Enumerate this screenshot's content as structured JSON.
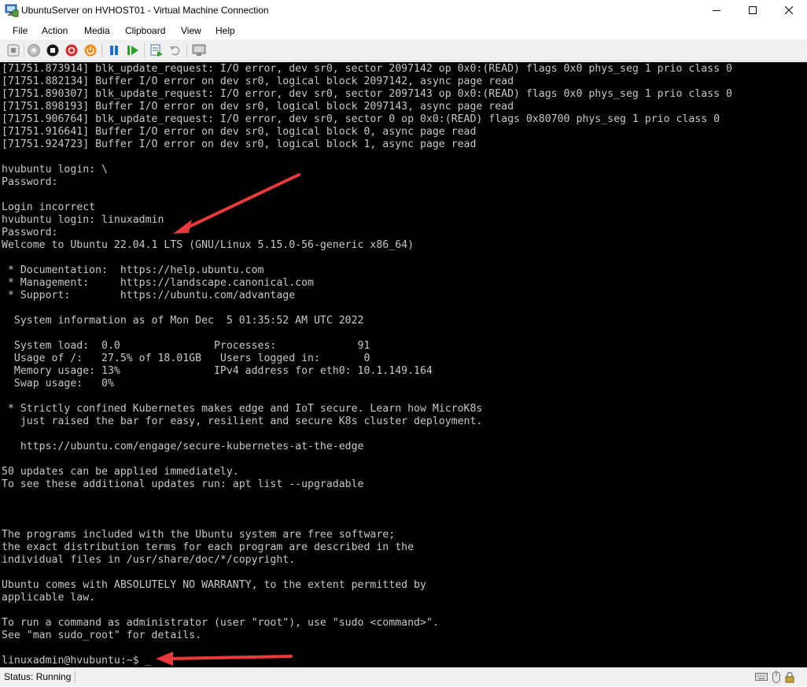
{
  "window": {
    "title": "UbuntuServer on HVHOST01 - Virtual Machine Connection",
    "icon": "vm-connection-icon",
    "controls": [
      "minimize-icon",
      "maximize-icon",
      "close-icon"
    ]
  },
  "menu": {
    "items": [
      {
        "label": "File"
      },
      {
        "label": "Action"
      },
      {
        "label": "Media"
      },
      {
        "label": "Clipboard"
      },
      {
        "label": "View"
      },
      {
        "label": "Help"
      }
    ]
  },
  "toolbar": {
    "buttons": [
      "ctrl-alt-del-icon",
      "start-icon",
      "turn-off-icon",
      "shutdown-icon",
      "save-icon",
      "pause-icon",
      "resume-icon",
      "checkpoint-icon",
      "revert-icon",
      "enhanced-session-icon"
    ]
  },
  "console": {
    "text": "[71751.873914] blk_update_request: I/O error, dev sr0, sector 2097142 op 0x0:(READ) flags 0x0 phys_seg 1 prio class 0\n[71751.882134] Buffer I/O error on dev sr0, logical block 2097142, async page read\n[71751.890307] blk_update_request: I/O error, dev sr0, sector 2097143 op 0x0:(READ) flags 0x0 phys_seg 1 prio class 0\n[71751.898193] Buffer I/O error on dev sr0, logical block 2097143, async page read\n[71751.906764] blk_update_request: I/O error, dev sr0, sector 0 op 0x0:(READ) flags 0x80700 phys_seg 1 prio class 0\n[71751.916641] Buffer I/O error on dev sr0, logical block 0, async page read\n[71751.924723] Buffer I/O error on dev sr0, logical block 1, async page read\n\nhvubuntu login: \\\nPassword:\n\nLogin incorrect\nhvubuntu login: linuxadmin\nPassword:\nWelcome to Ubuntu 22.04.1 LTS (GNU/Linux 5.15.0-56-generic x86_64)\n\n * Documentation:  https://help.ubuntu.com\n * Management:     https://landscape.canonical.com\n * Support:        https://ubuntu.com/advantage\n\n  System information as of Mon Dec  5 01:35:52 AM UTC 2022\n\n  System load:  0.0               Processes:             91\n  Usage of /:   27.5% of 18.01GB   Users logged in:       0\n  Memory usage: 13%               IPv4 address for eth0: 10.1.149.164\n  Swap usage:   0%\n\n * Strictly confined Kubernetes makes edge and IoT secure. Learn how MicroK8s\n   just raised the bar for easy, resilient and secure K8s cluster deployment.\n\n   https://ubuntu.com/engage/secure-kubernetes-at-the-edge\n\n50 updates can be applied immediately.\nTo see these additional updates run: apt list --upgradable\n\n\n\nThe programs included with the Ubuntu system are free software;\nthe exact distribution terms for each program are described in the\nindividual files in /usr/share/doc/*/copyright.\n\nUbuntu comes with ABSOLUTELY NO WARRANTY, to the extent permitted by\napplicable law.\n\nTo run a command as administrator (user \"root\"), use \"sudo <command>\".\nSee \"man sudo_root\" for details.\n\nlinuxadmin@hvubuntu:~$ _"
  },
  "status": {
    "label": "Status: Running",
    "icons": [
      "keyboard-icon",
      "mouse-icon",
      "lock-icon"
    ]
  },
  "colors": {
    "console_bg": "#000000",
    "console_fg": "#c8c8c8",
    "annotation_arrow": "#e83a3a"
  }
}
